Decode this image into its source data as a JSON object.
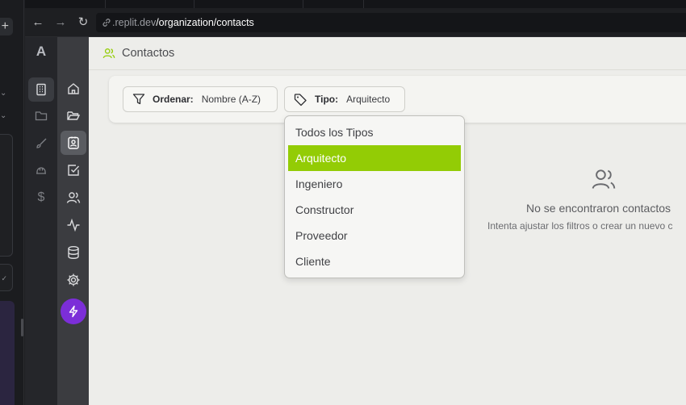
{
  "browser": {
    "url_domain": ".replit.dev",
    "url_path": "/organization/contacts"
  },
  "app": {
    "logo": "A",
    "page_title": "Contactos"
  },
  "filters": {
    "sort_label": "Ordenar:",
    "sort_value": "Nombre (A-Z)",
    "type_label": "Tipo:",
    "type_value": "Arquitecto"
  },
  "type_dropdown": {
    "options": [
      "Todos los Tipos",
      "Arquitecto",
      "Ingeniero",
      "Constructor",
      "Proveedor",
      "Cliente"
    ],
    "selected": "Arquitecto"
  },
  "empty_state": {
    "title": "No se encontraron contactos",
    "subtitle": "Intenta ajustar los filtros o crear un nuevo c"
  },
  "colors": {
    "accent_green": "#93cc05",
    "bolt_purple": "#7c2ed8"
  }
}
